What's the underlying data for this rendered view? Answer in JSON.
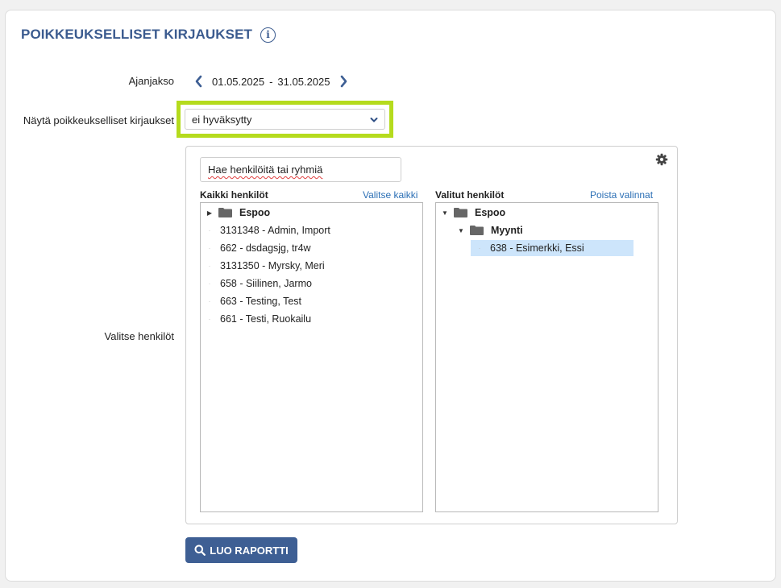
{
  "page": {
    "title": "POIKKEUKSELLISET KIRJAUKSET",
    "info_icon": "info-circle-icon"
  },
  "period": {
    "label": "Ajanjakso",
    "start": "01.05.2025",
    "separator": "-",
    "end": "31.05.2025",
    "prev_icon": "chevron-left-icon",
    "next_icon": "chevron-right-icon"
  },
  "filter": {
    "label": "Näytä poikkeukselliset kirjaukset",
    "selected_value": "ei hyväksytty",
    "highlight_color": "#b5db1d"
  },
  "persons": {
    "label": "Valitse henkilöt",
    "search_placeholder": "Hae henkilöitä tai ryhmiä",
    "all": {
      "header": "Kaikki henkilöt",
      "select_all": "Valitse kaikki",
      "root": "Espoo",
      "items": [
        "3131348 - Admin, Import",
        "662 - dsdagsjg, tr4w",
        "3131350 - Myrsky, Meri",
        "658 - Siilinen, Jarmo",
        "663 - Testing, Test",
        "661 - Testi, Ruokailu"
      ]
    },
    "selected": {
      "header": "Valitut henkilöt",
      "clear": "Poista valinnat",
      "root": "Espoo",
      "group": "Myynti",
      "items": [
        "638 - Esimerkki, Essi"
      ]
    }
  },
  "actions": {
    "create_report": "LUO RAPORTTI",
    "accent_color": "#3e5f94"
  }
}
